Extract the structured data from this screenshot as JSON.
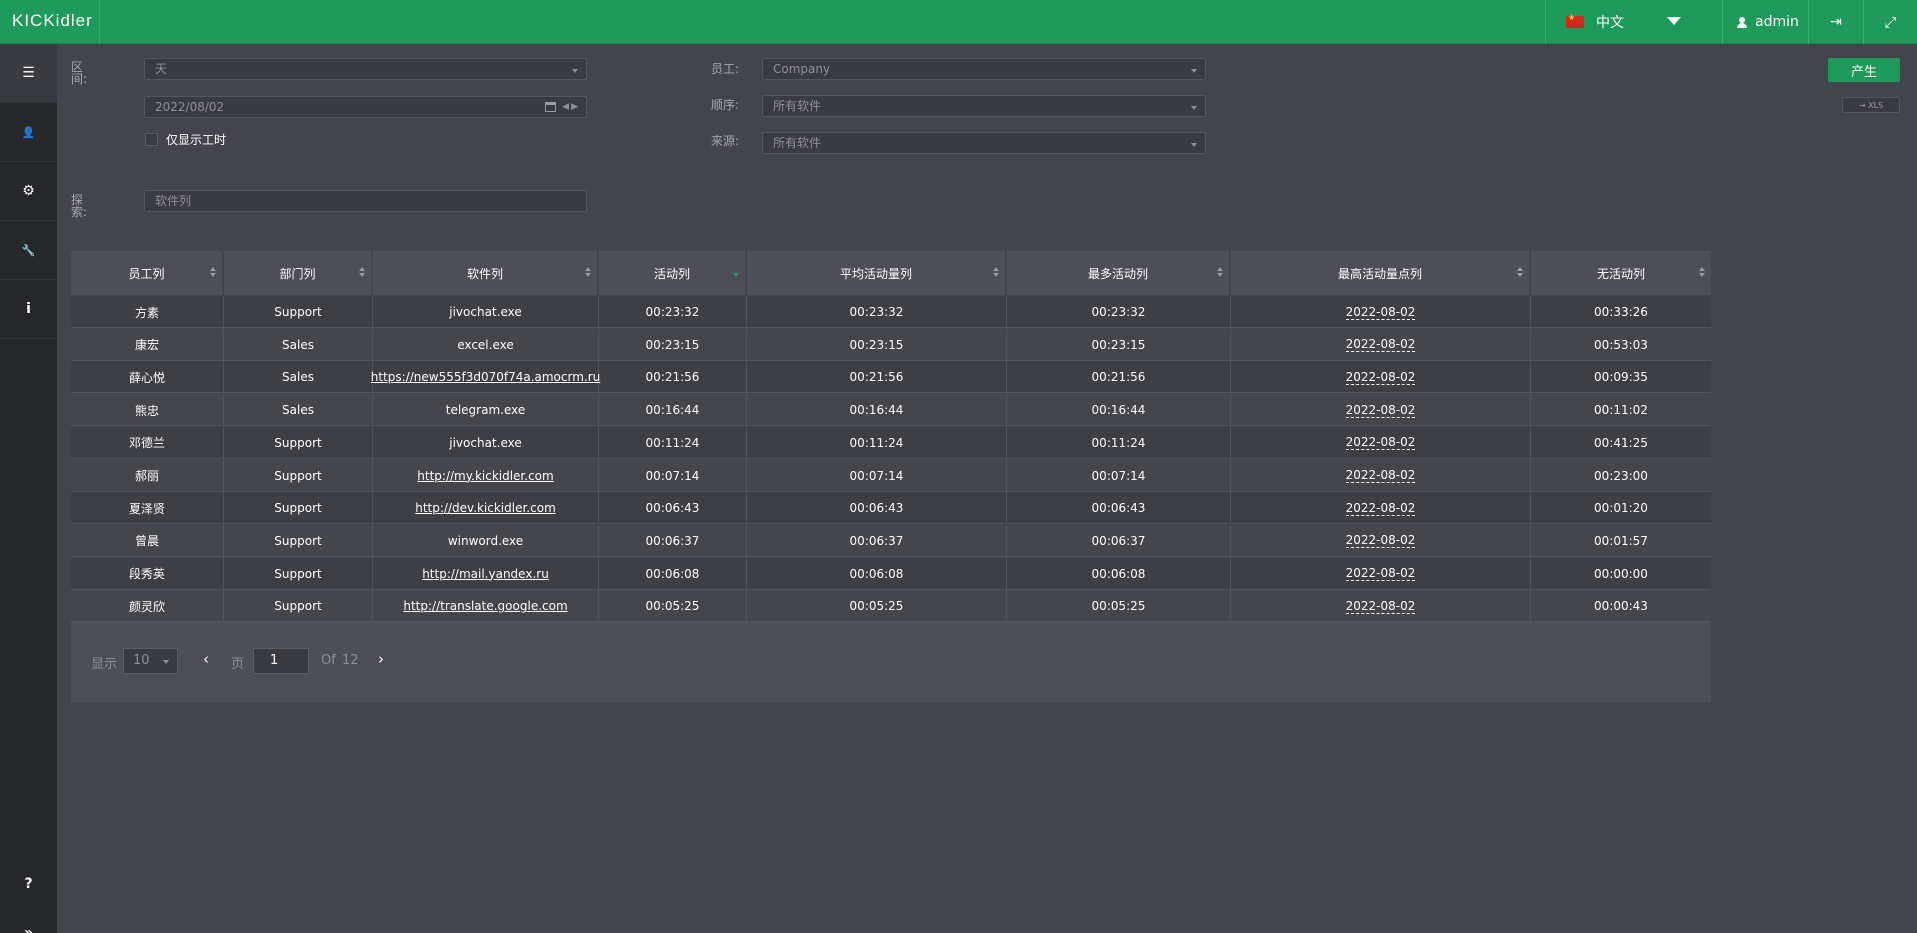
{
  "app": {
    "logo": "KICKidler"
  },
  "topbar": {
    "language": "中文",
    "user": "admin",
    "logout_icon": "sign-out-icon",
    "expand_icon": "expand-icon"
  },
  "sidebar": {
    "items": [
      {
        "icon": "list-icon",
        "glyph": "☰"
      },
      {
        "icon": "user-icon",
        "glyph": "👤"
      },
      {
        "icon": "gears-icon",
        "glyph": "⚙"
      },
      {
        "icon": "wrench-icon",
        "glyph": "🔧"
      },
      {
        "icon": "info-icon",
        "glyph": "i"
      }
    ],
    "help": "?",
    "collapse": "»"
  },
  "filters": {
    "period_label": "区\n间:",
    "period_value": "天",
    "date_value": "2022/08/02",
    "work_hours_label": "仅显示工时",
    "employee_label": "员工:",
    "employee_value": "Company",
    "order_label": "顺序:",
    "order_value": "所有软件",
    "source_label": "来源:",
    "source_value": "所有软件",
    "search_label": "探\n索:",
    "search_placeholder": "软件列"
  },
  "actions": {
    "generate": "产生",
    "xls": "→ XLS"
  },
  "table": {
    "columns": [
      "员工列",
      "部门列",
      "软件列",
      "活动列",
      "平均活动量列",
      "最多活动列",
      "最高活动量点列",
      "无活动列"
    ],
    "rows": [
      {
        "employee": "方素",
        "department": "Support",
        "software": "jivochat.exe",
        "link": false,
        "activity": "00:23:32",
        "avg": "00:23:32",
        "max": "00:23:32",
        "peak": "2022-08-02",
        "idle": "00:33:26"
      },
      {
        "employee": "康宏",
        "department": "Sales",
        "software": "excel.exe",
        "link": false,
        "activity": "00:23:15",
        "avg": "00:23:15",
        "max": "00:23:15",
        "peak": "2022-08-02",
        "idle": "00:53:03"
      },
      {
        "employee": "薛心悦",
        "department": "Sales",
        "software": "https://new555f3d070f74a.amocrm.ru",
        "link": true,
        "activity": "00:21:56",
        "avg": "00:21:56",
        "max": "00:21:56",
        "peak": "2022-08-02",
        "idle": "00:09:35"
      },
      {
        "employee": "熊忠",
        "department": "Sales",
        "software": "telegram.exe",
        "link": false,
        "activity": "00:16:44",
        "avg": "00:16:44",
        "max": "00:16:44",
        "peak": "2022-08-02",
        "idle": "00:11:02"
      },
      {
        "employee": "邓德兰",
        "department": "Support",
        "software": "jivochat.exe",
        "link": false,
        "activity": "00:11:24",
        "avg": "00:11:24",
        "max": "00:11:24",
        "peak": "2022-08-02",
        "idle": "00:41:25"
      },
      {
        "employee": "郝丽",
        "department": "Support",
        "software": "http://my.kickidler.com",
        "link": true,
        "activity": "00:07:14",
        "avg": "00:07:14",
        "max": "00:07:14",
        "peak": "2022-08-02",
        "idle": "00:23:00"
      },
      {
        "employee": "夏泽贤",
        "department": "Support",
        "software": "http://dev.kickidler.com",
        "link": true,
        "activity": "00:06:43",
        "avg": "00:06:43",
        "max": "00:06:43",
        "peak": "2022-08-02",
        "idle": "00:01:20"
      },
      {
        "employee": "曾晨",
        "department": "Support",
        "software": "winword.exe",
        "link": false,
        "activity": "00:06:37",
        "avg": "00:06:37",
        "max": "00:06:37",
        "peak": "2022-08-02",
        "idle": "00:01:57"
      },
      {
        "employee": "段秀英",
        "department": "Support",
        "software": "http://mail.yandex.ru",
        "link": true,
        "activity": "00:06:08",
        "avg": "00:06:08",
        "max": "00:06:08",
        "peak": "2022-08-02",
        "idle": "00:00:00"
      },
      {
        "employee": "颜灵欣",
        "department": "Support",
        "software": "http://translate.google.com",
        "link": true,
        "activity": "00:05:25",
        "avg": "00:05:25",
        "max": "00:05:25",
        "peak": "2022-08-02",
        "idle": "00:00:43"
      }
    ]
  },
  "pagination": {
    "show_label": "显示",
    "page_size": "10",
    "prev": "‹",
    "page_label": "页",
    "page": "1",
    "of_label": "Of",
    "total_pages": "12",
    "next": "›"
  }
}
